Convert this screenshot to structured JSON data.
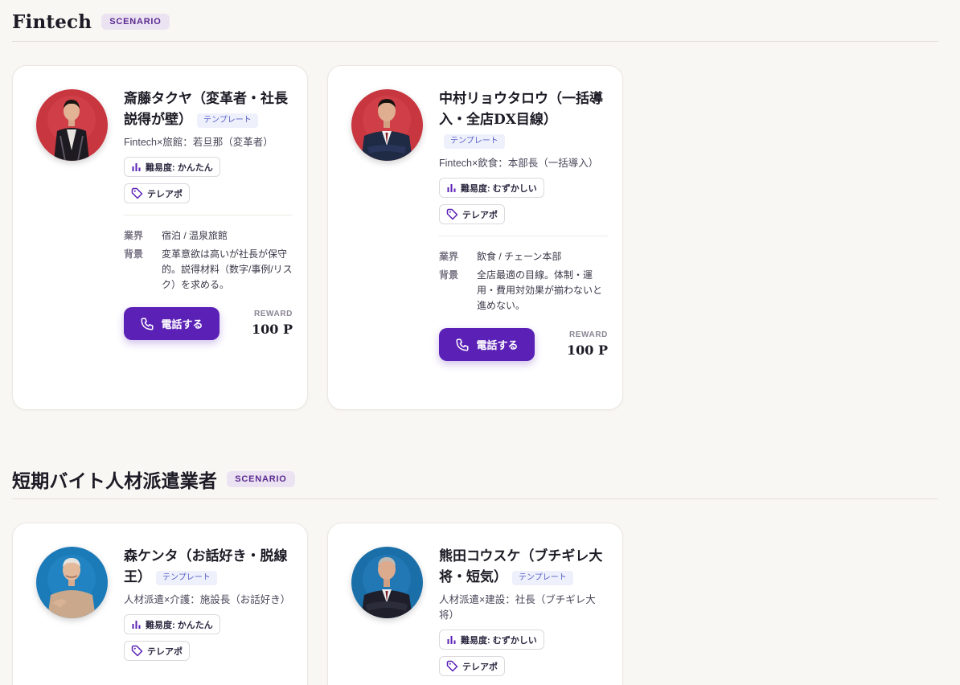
{
  "sections": [
    {
      "title": "Fintech",
      "badge": "SCENARIO",
      "cards": [
        {
          "name": "斎藤タクヤ（変革者・社長説得が壁）",
          "template_label": "テンプレート",
          "subtitle": "Fintech×旅館：若旦那（変革者）",
          "difficulty": "難易度: かんたん",
          "tag": "テレアポ",
          "industry_label": "業界",
          "industry": "宿泊 / 温泉旅館",
          "background_label": "背景",
          "background": "変革意欲は高いが社長が保守的。説得材料（数字/事例/リスク）を求める。",
          "call_label": "電話する",
          "reward_label": "REWARD",
          "reward": "100 P",
          "avatar_bg": "#c8363f"
        },
        {
          "name": "中村リョウタロウ（一括導入・全店DX目線）",
          "template_label": "テンプレート",
          "subtitle": "Fintech×飲食：本部長（一括導入）",
          "difficulty": "難易度: むずかしい",
          "tag": "テレアポ",
          "industry_label": "業界",
          "industry": "飲食 / チェーン本部",
          "background_label": "背景",
          "background": "全店最適の目線。体制・運用・費用対効果が揃わないと進めない。",
          "call_label": "電話する",
          "reward_label": "REWARD",
          "reward": "100 P",
          "avatar_bg": "#c8363f"
        }
      ]
    },
    {
      "title": "短期バイト人材派遣業者",
      "badge": "SCENARIO",
      "cards": [
        {
          "name": "森ケンタ（お話好き・脱線王）",
          "template_label": "テンプレート",
          "subtitle": "人材派遣×介護：施設長（お話好き）",
          "difficulty": "難易度: かんたん",
          "tag": "テレアポ",
          "avatar_bg": "#1b7ab8"
        },
        {
          "name": "熊田コウスケ（ブチギレ大将・短気）",
          "template_label": "テンプレート",
          "subtitle": "人材派遣×建設：社長（ブチギレ大将）",
          "difficulty": "難易度: むずかしい",
          "tag": "テレアポ",
          "avatar_bg": "#1b6fa8"
        }
      ]
    }
  ]
}
